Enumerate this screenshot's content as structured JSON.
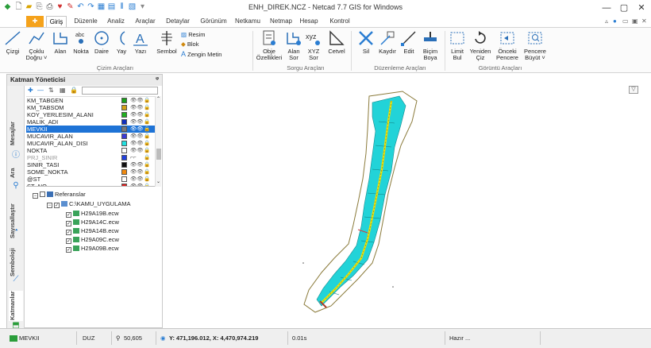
{
  "window": {
    "title": "ENH_DIREK.NCZ - Netcad 7.7 GIS for Windows",
    "minimize": "—",
    "maximize": "▢",
    "close": "✕"
  },
  "tabs": [
    {
      "label": "Giriş"
    },
    {
      "label": "Düzenle"
    },
    {
      "label": "Analiz"
    },
    {
      "label": "Araçlar"
    },
    {
      "label": "Detaylar"
    },
    {
      "label": "Görünüm"
    },
    {
      "label": "Netkamu"
    },
    {
      "label": "Netmap"
    },
    {
      "label": "Hesap"
    },
    {
      "label": "Kontrol"
    }
  ],
  "ribbon": {
    "cizim": {
      "group_label": "Çizim Araçları",
      "cizgi": "Çizgi",
      "coklu": "Çoklu",
      "dogru": "Doğru ˅",
      "alan": "Alan",
      "nokta": "Nokta",
      "daire": "Daire",
      "yay": "Yay",
      "yazi": "Yazı",
      "sembol": "Sembol",
      "resim": "Resim",
      "blok": "Blok",
      "zengin_metin": "Zengin Metin"
    },
    "sorgu": {
      "group_label": "Sorgu Araçları",
      "obje": "Obje",
      "ozellikleri": "Özellikleri",
      "alan": "Alan",
      "sor": "Sor",
      "xyz": "XYZ",
      "xyz_sor": "Sor",
      "cetvel": "Cetvel"
    },
    "duzenleme": {
      "group_label": "Düzenleme Araçları",
      "sil": "Sil",
      "kaydir": "Kaydır",
      "edit": "Edit",
      "bicim": "Biçim",
      "boya": "Boya"
    },
    "goruntu": {
      "group_label": "Görüntü Araçları",
      "limit": "Limit",
      "bul": "Bul",
      "yeniden": "Yeniden",
      "ciz": "Çiz",
      "onceki": "Önceki",
      "pencere": "Pencere",
      "pencere2": "Pencere",
      "buyut": "Büyüt ˅"
    }
  },
  "panel": {
    "title": "Katman Yöneticisi",
    "pin": "ᵠ",
    "side_tabs": [
      "Mesajlar",
      "Ara",
      "Sayısallaştır",
      "Semboloji",
      "Katmanlar"
    ],
    "layers": [
      {
        "name": "KM_TABGEN",
        "color": "#1aa01a",
        "eye": "👁👁",
        "lock": "🔒"
      },
      {
        "name": "KM_TABSOM",
        "color": "#d4a017",
        "eye": "👁👁",
        "lock": "🔒"
      },
      {
        "name": "KOY_YERLESIM_ALANI",
        "color": "#20b020",
        "eye": "👁👁",
        "lock": "🔒"
      },
      {
        "name": "MALIK_ADI",
        "color": "#1030c0",
        "eye": "👁👁",
        "lock": "🔒"
      },
      {
        "name": "MEVKII",
        "color": "#7a7a7a",
        "eye": "👁👁",
        "lock": "🔒"
      },
      {
        "name": "MUCAVIR_ALAN",
        "color": "#3a3ad8",
        "eye": "👁👁",
        "lock": "🔒"
      },
      {
        "name": "MUCAVIR_ALAN_DISI",
        "color": "#22e0e0",
        "eye": "👁👁",
        "lock": "🔒"
      },
      {
        "name": "NOKTA",
        "color": "#ffffff",
        "eye": "👁👁",
        "lock": "🔒"
      },
      {
        "name": "PRJ_SINIR",
        "color": "#2040e0",
        "eye": "⌐⌐",
        "lock": "🔒"
      },
      {
        "name": "SINIR_TASI",
        "color": "#111111",
        "eye": "👁👁",
        "lock": "🔒"
      },
      {
        "name": "SOME_NOKTA",
        "color": "#f08a10",
        "eye": "👁👁",
        "lock": "🔒"
      },
      {
        "name": "@ST",
        "color": "#ffffff",
        "eye": "👁👁",
        "lock": "🔒"
      },
      {
        "name": "ST_NO",
        "color": "#e02020",
        "eye": "👁👁",
        "lock": "🔒"
      }
    ],
    "tree": {
      "root": "Referanslar",
      "folder": "C:\\KAMU_UYGULAMA",
      "files": [
        "H29A19B.ecw",
        "H29A14C.ecw",
        "H29A14B.ecw",
        "H29A09C.ecw",
        "H29A09B.ecw"
      ]
    }
  },
  "map_tool": "▽",
  "status": {
    "layer": "MEVKII",
    "mode": "DUZ",
    "zoom": "50,605",
    "coords": "Y: 471,196.012, X: 4,470,974.219",
    "time": "0.01s",
    "ready": "Hazır ..."
  },
  "colors": {
    "accent_orange": "#f5a21b",
    "selection_blue": "#1e73d6",
    "road_yellow": "#f2e600",
    "parcel_cyan": "#22d3d8",
    "boundary_olive": "#8a7a3a"
  }
}
